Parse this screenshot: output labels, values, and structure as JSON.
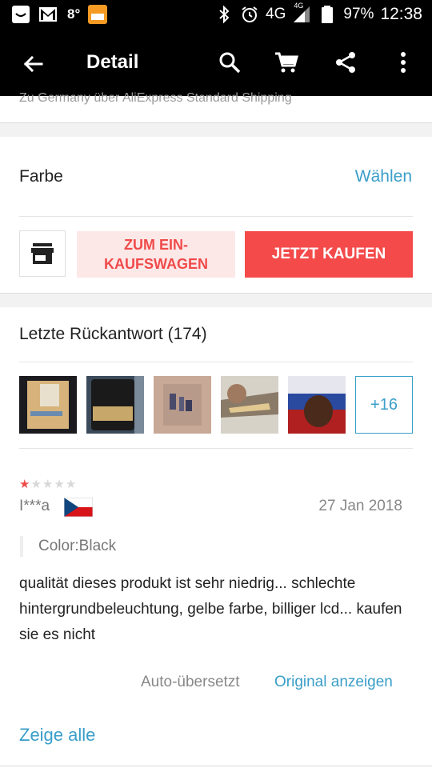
{
  "status_bar": {
    "temperature": "8°",
    "network": "4G",
    "network_small": "4G",
    "battery": "97%",
    "time": "12:38",
    "app_icon_label": "SMART STAT"
  },
  "app_bar": {
    "title": "Detail"
  },
  "shipping": {
    "text": "Zu Germany über AliExpress Standard Shipping"
  },
  "color_row": {
    "label": "Farbe",
    "action": "Wählen"
  },
  "buttons": {
    "add_to_cart_line1": "ZUM EIN-",
    "add_to_cart_line2": "KAUFSWAGEN",
    "buy_now": "JETZT KAUFEN"
  },
  "reviews": {
    "title": "Letzte Rückantwort (174)",
    "more_photos": "+16",
    "rating": 1,
    "rating_max": 5,
    "user": "I***a",
    "date": "27 Jan 2018",
    "color": "Color:Black",
    "text": "qualität dieses produkt ist sehr niedrig... schlechte hintergrundbeleuchtung, gelbe farbe, billiger lcd... kaufen sie es nicht",
    "auto_translated": "Auto-übersetzt",
    "show_original": "Original anzeigen",
    "show_all": "Zeige alle"
  },
  "colors": {
    "accent_blue": "#3a9ec9",
    "buy_red": "#f44a4a",
    "cart_pink": "#fde8e8",
    "cart_text": "#f04a4a"
  }
}
